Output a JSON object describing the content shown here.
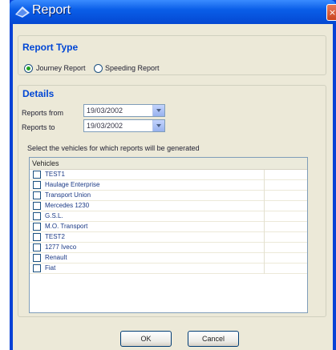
{
  "window": {
    "title": "Report",
    "close_label": "×"
  },
  "report_type": {
    "group_title": "Report Type",
    "options": [
      {
        "label": "Journey Report",
        "checked": true
      },
      {
        "label": "Speeding Report",
        "checked": false
      }
    ]
  },
  "details": {
    "group_title": "Details",
    "reports_from_label": "Reports from",
    "reports_from_value": "19/03/2002",
    "reports_to_label": "Reports to",
    "reports_to_value": "19/03/2002",
    "instruction": "Select the vehicles for which reports will be generated"
  },
  "vehicles": {
    "header": "Vehicles",
    "rows": [
      "TEST1",
      "Haulage Enterprise",
      "Transport Union",
      "Mercedes 1230",
      "G.S.L.",
      "M.O. Transport",
      "TEST2",
      "1277 Iveco",
      "Renault",
      "Fiat"
    ]
  },
  "buttons": {
    "ok_label": "OK",
    "cancel_label": "Cancel"
  }
}
